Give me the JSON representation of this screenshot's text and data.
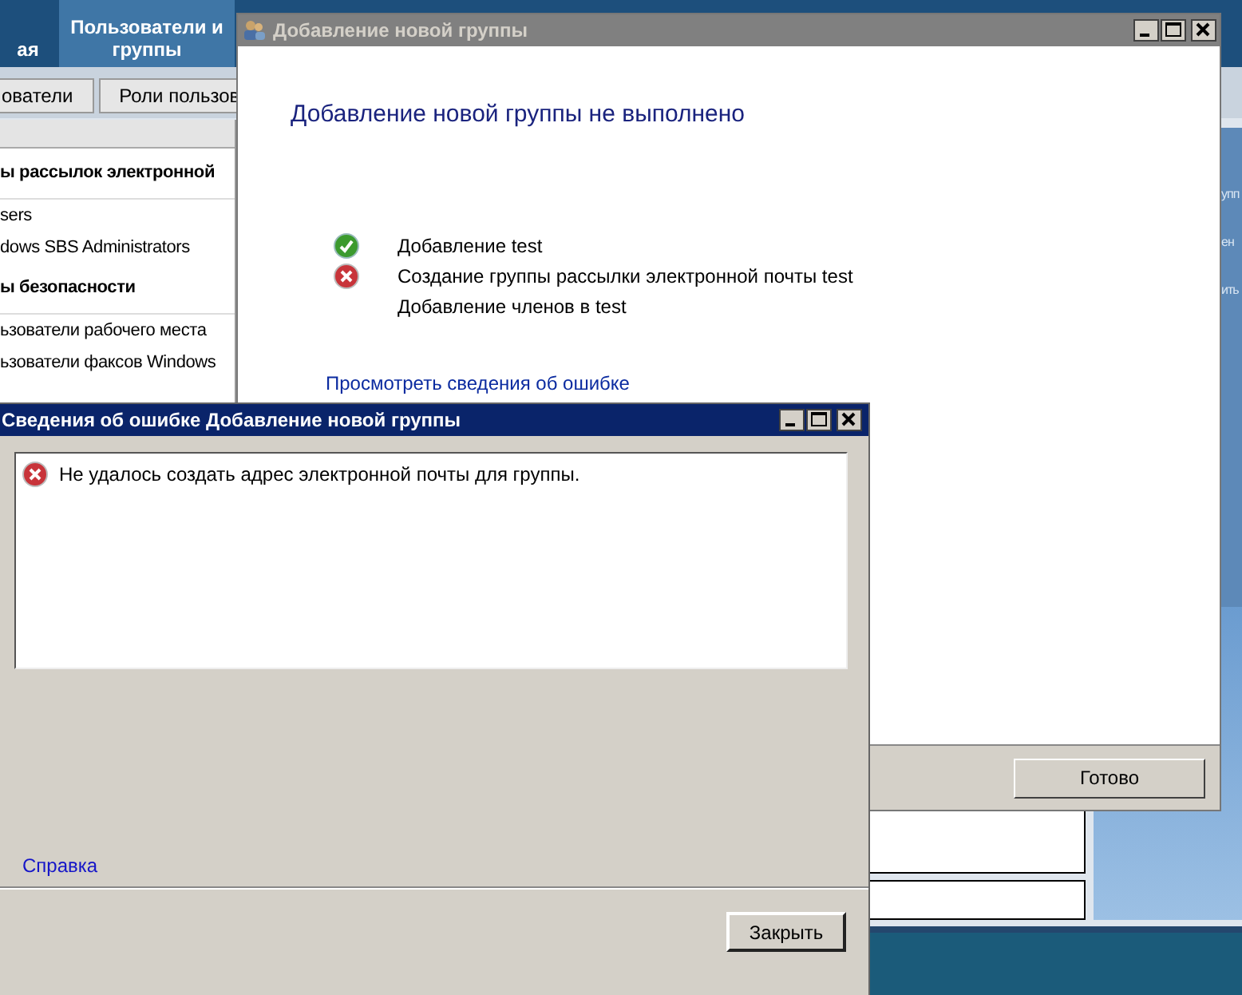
{
  "background_app": {
    "nav_tabs": [
      {
        "label": "ая",
        "selected": false
      },
      {
        "label": "Пользователи и группы",
        "selected": true
      }
    ],
    "sub_tabs": [
      "ователи",
      "Роли пользов"
    ],
    "list": [
      {
        "kind": "header",
        "text": "ы рассылок электронной"
      },
      {
        "kind": "item",
        "text": "sers"
      },
      {
        "kind": "item",
        "text": "dows SBS Administrators"
      },
      {
        "kind": "header",
        "text": "ы безопасности"
      },
      {
        "kind": "item",
        "text": "ьзователи рабочего места"
      },
      {
        "kind": "item",
        "text": "ьзователи факсов Windows"
      }
    ],
    "side_texts": [
      "упп",
      "ен",
      "ить"
    ]
  },
  "main_dialog": {
    "title": "Добавление новой группы",
    "active": false,
    "heading": "Добавление новой группы не выполнено",
    "steps": [
      {
        "kind": "success",
        "text": "Добавление test"
      },
      {
        "kind": "error",
        "text": "Создание группы рассылки электронной почты test"
      },
      {
        "kind": "plain",
        "text": "Добавление членов в test"
      }
    ],
    "details_link": "Просмотреть сведения об ошибке",
    "done_button": "Готово"
  },
  "error_dialog": {
    "title": "Сведения об ошибке Добавление новой группы",
    "active": true,
    "messages": [
      {
        "kind": "error",
        "text": "Не удалось создать адрес электронной почты для группы."
      }
    ],
    "help_link": "Справка",
    "close_button": "Закрыть"
  }
}
